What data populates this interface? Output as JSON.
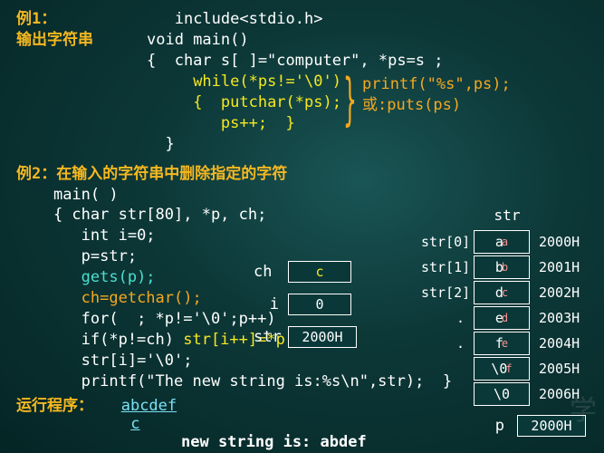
{
  "ex1": {
    "label": "例1：",
    "subtitle": "输出字符串",
    "code": {
      "l1": "include<stdio.h>",
      "l2": "void main()",
      "l3": "{  char s[ ]=\"computer\", *ps=s ;",
      "l4": "while(*ps!='\\0')",
      "l5": "{  putchar(*ps);",
      "l6": "ps++;  }",
      "l7": "}"
    },
    "note": {
      "l1": "printf(\"%s\",ps);",
      "l2": "或:puts(ps)"
    }
  },
  "ex2": {
    "label": "例2：在输入的字符串中删除指定的字符",
    "code": {
      "l1": "main( )",
      "l2": "{ char str[80], *p, ch;",
      "l3": "   int i=0;",
      "l4": "   p=str;",
      "l5": "   gets(p);",
      "l6": "   ch=getchar();",
      "l7": "   for(  ; *p!='\\0';p++)",
      "l8_a": "       if(*p!=ch) ",
      "l8_b": "str[i++]=*p;",
      "l9": "   str[i]='\\0';",
      "l10": "   printf(\"The new string is:%s\\n\",str);  }"
    }
  },
  "vars": {
    "ch": {
      "label": "ch",
      "value": "c"
    },
    "i": {
      "label": "i",
      "value": "0"
    },
    "str": {
      "label": "str",
      "value": "2000H"
    }
  },
  "memory": {
    "header": "str",
    "rows": [
      {
        "label": "str[0]",
        "val": "a",
        "sup": "a",
        "addr": "2000H"
      },
      {
        "label": "str[1]",
        "val": "b",
        "sup": "b",
        "addr": "2001H"
      },
      {
        "label": "str[2]",
        "val": "d",
        "sup": "c",
        "addr": "2002H"
      },
      {
        "label": ".",
        "val": "e",
        "sup": "d",
        "addr": "2003H"
      },
      {
        "label": ".",
        "val": "f",
        "sup": " e",
        "addr": "2004H"
      },
      {
        "label": "",
        "val": "\\0",
        "sup": "f",
        "addr": "2005H"
      },
      {
        "label": "",
        "val": "\\0",
        "sup": "",
        "addr": "2006H"
      }
    ]
  },
  "p_var": {
    "label": "p",
    "value": "2000H"
  },
  "run": {
    "label": "运行程序：",
    "input1": "abcdef",
    "input2": "c",
    "result": "new string is: abdef"
  }
}
